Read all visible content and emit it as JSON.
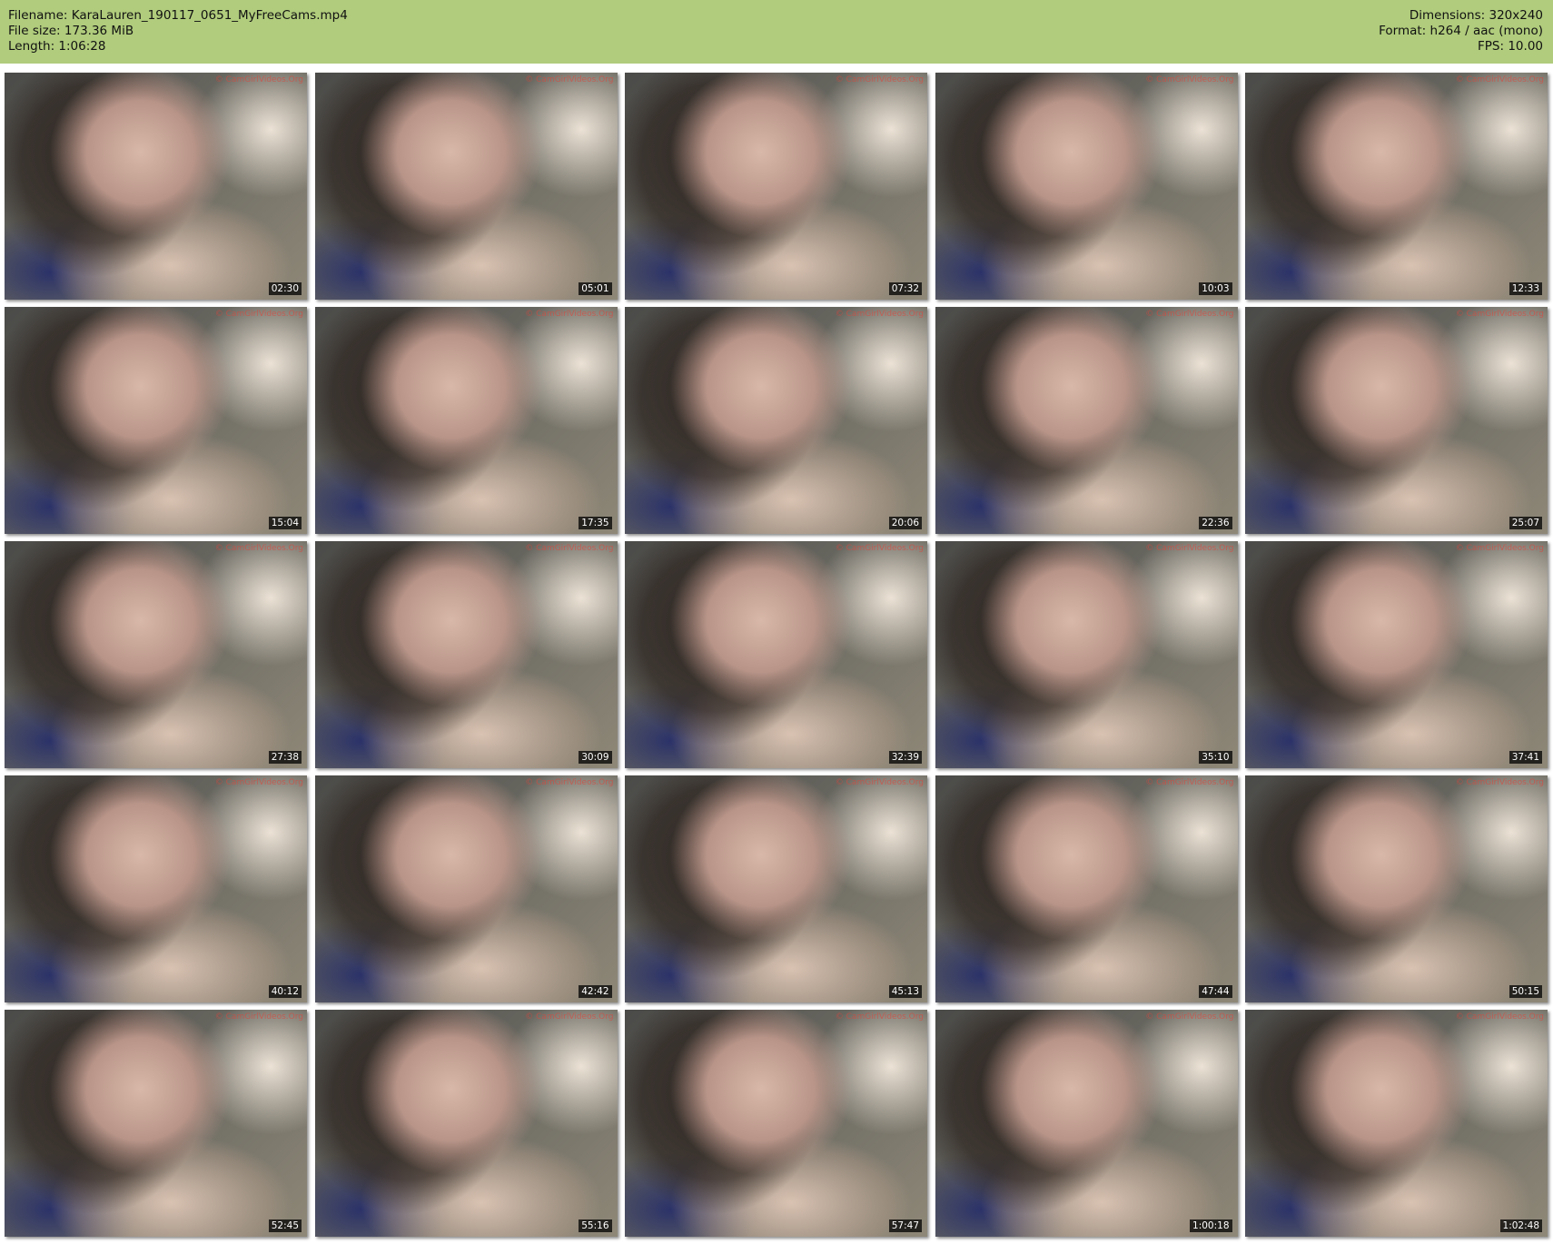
{
  "header": {
    "filename": "Filename: KaraLauren_190117_0651_MyFreeCams.mp4",
    "file_size": "File size: 173.36 MiB",
    "length": "Length: 1:06:28",
    "dimensions": "Dimensions: 320x240",
    "format": "Format: h264 / aac (mono)",
    "fps": "FPS: 10.00"
  },
  "watermark": "© CamGirlVideos.Org",
  "thumbnails": [
    {
      "time": "02:30"
    },
    {
      "time": "05:01"
    },
    {
      "time": "07:32"
    },
    {
      "time": "10:03"
    },
    {
      "time": "12:33"
    },
    {
      "time": "15:04"
    },
    {
      "time": "17:35"
    },
    {
      "time": "20:06"
    },
    {
      "time": "22:36"
    },
    {
      "time": "25:07"
    },
    {
      "time": "27:38"
    },
    {
      "time": "30:09"
    },
    {
      "time": "32:39"
    },
    {
      "time": "35:10"
    },
    {
      "time": "37:41"
    },
    {
      "time": "40:12"
    },
    {
      "time": "42:42"
    },
    {
      "time": "45:13"
    },
    {
      "time": "47:44"
    },
    {
      "time": "50:15"
    },
    {
      "time": "52:45"
    },
    {
      "time": "55:16"
    },
    {
      "time": "57:47"
    },
    {
      "time": "1:00:18"
    },
    {
      "time": "1:02:48"
    }
  ]
}
